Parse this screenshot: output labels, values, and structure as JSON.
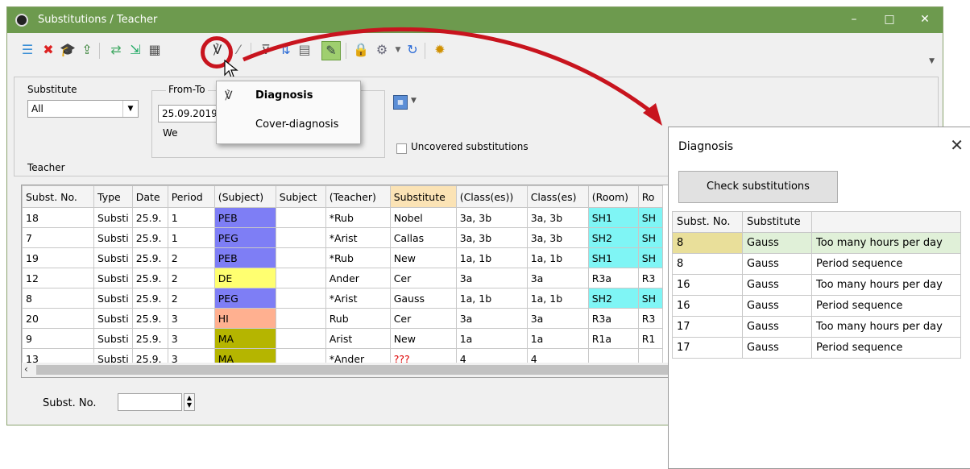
{
  "window": {
    "title": "Substitutions / Teacher",
    "controls": [
      "–",
      "□",
      "✕"
    ]
  },
  "filters": {
    "substitute_label": "Substitute",
    "substitute_value": "All",
    "from_to_label": "From-To",
    "date_value": "25.09.2019",
    "weekday": "We",
    "uncovered_label": "Uncovered substitutions",
    "teacher_label": "Teacher"
  },
  "popup_menu": {
    "items": [
      {
        "label": "Diagnosis",
        "bold": true,
        "icon": "stethoscope-icon"
      },
      {
        "label": "Cover-diagnosis",
        "bold": false,
        "icon": ""
      }
    ]
  },
  "grid": {
    "columns": [
      "Subst. No.",
      "Type",
      "Date",
      "Period",
      "(Subject)",
      "Subject",
      "(Teacher)",
      "Substitute",
      "(Class(es))",
      "Class(es)",
      "(Room)",
      "Ro"
    ],
    "rows": [
      [
        "18",
        "Substi",
        "25.9.",
        "1",
        "PEB",
        "",
        "*Rub",
        "Nobel",
        "3a, 3b",
        "3a, 3b",
        "SH1",
        "SH"
      ],
      [
        "7",
        "Substi",
        "25.9.",
        "1",
        "PEG",
        "",
        "*Arist",
        "Callas",
        "3a, 3b",
        "3a, 3b",
        "SH2",
        "SH"
      ],
      [
        "19",
        "Substi",
        "25.9.",
        "2",
        "PEB",
        "",
        "*Rub",
        "New",
        "1a, 1b",
        "1a, 1b",
        "SH1",
        "SH"
      ],
      [
        "12",
        "Substi",
        "25.9.",
        "2",
        "DE",
        "",
        "Ander",
        "Cer",
        "3a",
        "3a",
        "R3a",
        "R3"
      ],
      [
        "8",
        "Substi",
        "25.9.",
        "2",
        "PEG",
        "",
        "*Arist",
        "Gauss",
        "1a, 1b",
        "1a, 1b",
        "SH2",
        "SH"
      ],
      [
        "20",
        "Substi",
        "25.9.",
        "3",
        "HI",
        "",
        "Rub",
        "Cer",
        "3a",
        "3a",
        "R3a",
        "R3"
      ],
      [
        "9",
        "Substi",
        "25.9.",
        "3",
        "MA",
        "",
        "Arist",
        "New",
        "1a",
        "1a",
        "R1a",
        "R1"
      ],
      [
        "13",
        "Substi",
        "25.9.",
        "3",
        "MA",
        "",
        "*Ander",
        "???",
        "4",
        "4",
        "",
        ""
      ]
    ],
    "subject_colors": {
      "PEB": "#7e7ef5",
      "PEG": "#7e7ef5",
      "DE": "#ffff70",
      "HI": "#ffb090",
      "MA": "#b5b500"
    },
    "room_highlight_color": "#7ff5f5",
    "substitute_header_color": "#fbe3b5",
    "unknown_color": "#dd0000"
  },
  "footer": {
    "subst_no_label": "Subst. No."
  },
  "diagnosis": {
    "title": "Diagnosis",
    "button": "Check substitutions",
    "columns": [
      "Subst. No.",
      "Substitute",
      ""
    ],
    "rows": [
      [
        "8",
        "Gauss",
        "Too many hours per day"
      ],
      [
        "8",
        "Gauss",
        "Period sequence"
      ],
      [
        "16",
        "Gauss",
        "Too many hours per day"
      ],
      [
        "16",
        "Gauss",
        "Period sequence"
      ],
      [
        "17",
        "Gauss",
        "Too many hours per day"
      ],
      [
        "17",
        "Gauss",
        "Period sequence"
      ]
    ]
  },
  "toolbar_icons": [
    "list-icon",
    "delete-icon",
    "teacher-hat-icon",
    "export-icon",
    "swap-icon",
    "import-icon",
    "calculator-icon",
    "stethoscope-icon",
    "magic-wand-icon",
    "filter-icon",
    "sort-icon",
    "grid-icon",
    "edit-icon",
    "lock-icon",
    "document-settings-icon",
    "refresh-icon",
    "settings-gear-icon"
  ]
}
